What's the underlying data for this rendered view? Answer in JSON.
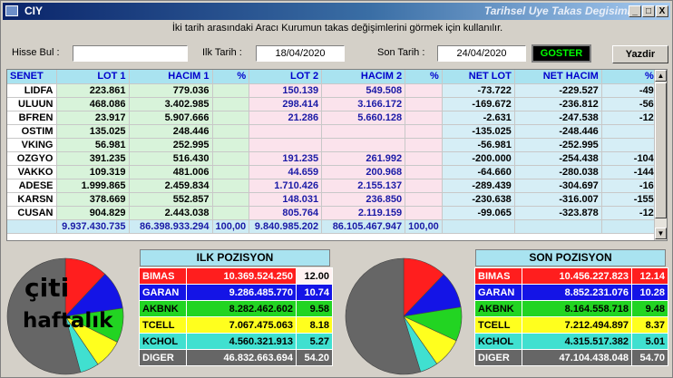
{
  "window": {
    "title": "CIY",
    "title_right": "Tarihsel Uye Takas Degisimi"
  },
  "window_buttons": {
    "min": "_",
    "max": "□",
    "close": "X"
  },
  "subtitle": "İki tarih arasındaki  Aracı Kurumun takas değişimlerini görmek için kullanılır.",
  "form": {
    "hisse_label": "Hisse Bul :",
    "hisse_value": "",
    "ilk_label": "Ilk Tarih :",
    "ilk_value": "18/04/2020",
    "son_label": "Son Tarih :",
    "son_value": "24/04/2020",
    "goster": "GOSTER",
    "yazdir": "Yazdir"
  },
  "grid": {
    "headers": [
      "SENET",
      "LOT 1",
      "HACIM 1",
      "%",
      "LOT 2",
      "HACIM 2",
      "%",
      "NET LOT",
      "NET HACIM",
      "%"
    ],
    "rows": [
      [
        "LIDFA",
        "223.861",
        "779.036",
        "",
        "150.139",
        "549.508",
        "",
        "-73.722",
        "-229.527",
        "-49"
      ],
      [
        "ULUUN",
        "468.086",
        "3.402.985",
        "",
        "298.414",
        "3.166.172",
        "",
        "-169.672",
        "-236.812",
        "-56"
      ],
      [
        "BFREN",
        "23.917",
        "5.907.666",
        "",
        "21.286",
        "5.660.128",
        "",
        "-2.631",
        "-247.538",
        "-12"
      ],
      [
        "OSTIM",
        "135.025",
        "248.446",
        "",
        "",
        "",
        "",
        "-135.025",
        "-248.446",
        ""
      ],
      [
        "VKING",
        "56.981",
        "252.995",
        "",
        "",
        "",
        "",
        "-56.981",
        "-252.995",
        ""
      ],
      [
        "OZGYO",
        "391.235",
        "516.430",
        "",
        "191.235",
        "261.992",
        "",
        "-200.000",
        "-254.438",
        "-104"
      ],
      [
        "VAKKO",
        "109.319",
        "481.006",
        "",
        "44.659",
        "200.968",
        "",
        "-64.660",
        "-280.038",
        "-144"
      ],
      [
        "ADESE",
        "1.999.865",
        "2.459.834",
        "",
        "1.710.426",
        "2.155.137",
        "",
        "-289.439",
        "-304.697",
        "-16"
      ],
      [
        "KARSN",
        "378.669",
        "552.857",
        "",
        "148.031",
        "236.850",
        "",
        "-230.638",
        "-316.007",
        "-155"
      ],
      [
        "CUSAN",
        "904.829",
        "2.443.038",
        "",
        "805.764",
        "2.119.159",
        "",
        "-99.065",
        "-323.878",
        "-12"
      ]
    ],
    "totals": [
      "",
      "9.937.430.735",
      "86.398.933.294",
      "100,00",
      "9.840.985.202",
      "86.105.467.947",
      "100,00",
      "",
      "",
      ""
    ]
  },
  "ilk_pozisyon": {
    "title": "ILK POZISYON",
    "rows": [
      {
        "name": "BIMAS",
        "value": "10.369.524.250",
        "pct": "12.00",
        "color": "#ff1e1e",
        "pct_bg": "#ffffff",
        "frac": 0.12
      },
      {
        "name": "GARAN",
        "value": "9.286.485.770",
        "pct": "10.74",
        "color": "#1414e6",
        "pct_bg": "#ffffff",
        "frac": 0.1074
      },
      {
        "name": "AKBNK",
        "value": "8.282.462.602",
        "pct": "9.58",
        "color": "#22d422",
        "pct_bg": "#ffffff",
        "frac": 0.0958
      },
      {
        "name": "TCELL",
        "value": "7.067.475.063",
        "pct": "8.18",
        "color": "#ffff1e",
        "pct_bg": "#ffffff",
        "frac": 0.0818
      },
      {
        "name": "KCHOL",
        "value": "4.560.321.913",
        "pct": "5.27",
        "color": "#40e0d0",
        "pct_bg": "#ffffff",
        "frac": 0.0527
      },
      {
        "name": "DIGER",
        "value": "46.832.663.694",
        "pct": "54.20",
        "color": "#666666",
        "pct_bg": "#ffffff",
        "frac": 0.542
      }
    ]
  },
  "son_pozisyon": {
    "title": "SON POZISYON",
    "rows": [
      {
        "name": "BIMAS",
        "value": "10.456.227.823",
        "pct": "12.14",
        "color": "#ff1e1e",
        "frac": 0.1214
      },
      {
        "name": "GARAN",
        "value": "8.852.231.076",
        "pct": "10.28",
        "color": "#1414e6",
        "frac": 0.1028
      },
      {
        "name": "AKBNK",
        "value": "8.164.558.718",
        "pct": "9.48",
        "color": "#22d422",
        "frac": 0.0948
      },
      {
        "name": "TCELL",
        "value": "7.212.494.897",
        "pct": "8.37",
        "color": "#ffff1e",
        "frac": 0.0837
      },
      {
        "name": "KCHOL",
        "value": "4.315.517.382",
        "pct": "5.01",
        "color": "#40e0d0",
        "frac": 0.0501
      },
      {
        "name": "DIGER",
        "value": "47.104.438.048",
        "pct": "54.70",
        "color": "#666666",
        "frac": 0.547
      }
    ]
  },
  "overlay": {
    "line1": "çiti",
    "line2": "haftalık"
  }
}
